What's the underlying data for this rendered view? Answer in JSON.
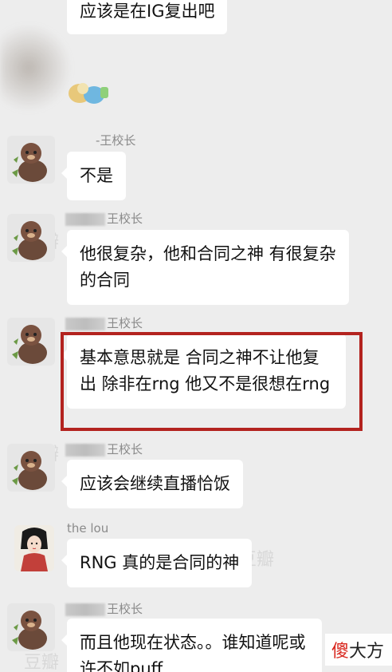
{
  "messages": [
    {
      "id": 0,
      "sender": "",
      "text": "应该是在IG复出吧"
    },
    {
      "id": 1,
      "sender": "-王校长",
      "text": "不是"
    },
    {
      "id": 2,
      "sender": "王校长",
      "text": "他很复杂，他和合同之神 有很复杂的合同"
    },
    {
      "id": 3,
      "sender": "王校长",
      "text": "基本意思就是 合同之神不让他复出 除非在rng 他又不是很想在rng"
    },
    {
      "id": 4,
      "sender": "王校长",
      "text": "应该会继续直播恰饭"
    },
    {
      "id": 5,
      "sender": "the lou",
      "text": "RNG 真的是合同的神"
    },
    {
      "id": 6,
      "sender": "王校长",
      "text": "而且他现在状态。。谁知道呢或许不如puff"
    }
  ],
  "watermark": "豆瓣",
  "logo": {
    "red": "傻",
    "rest": "大方"
  },
  "colors": {
    "background": "#ededed",
    "bubble": "#ffffff",
    "highlight": "#b3231f"
  }
}
